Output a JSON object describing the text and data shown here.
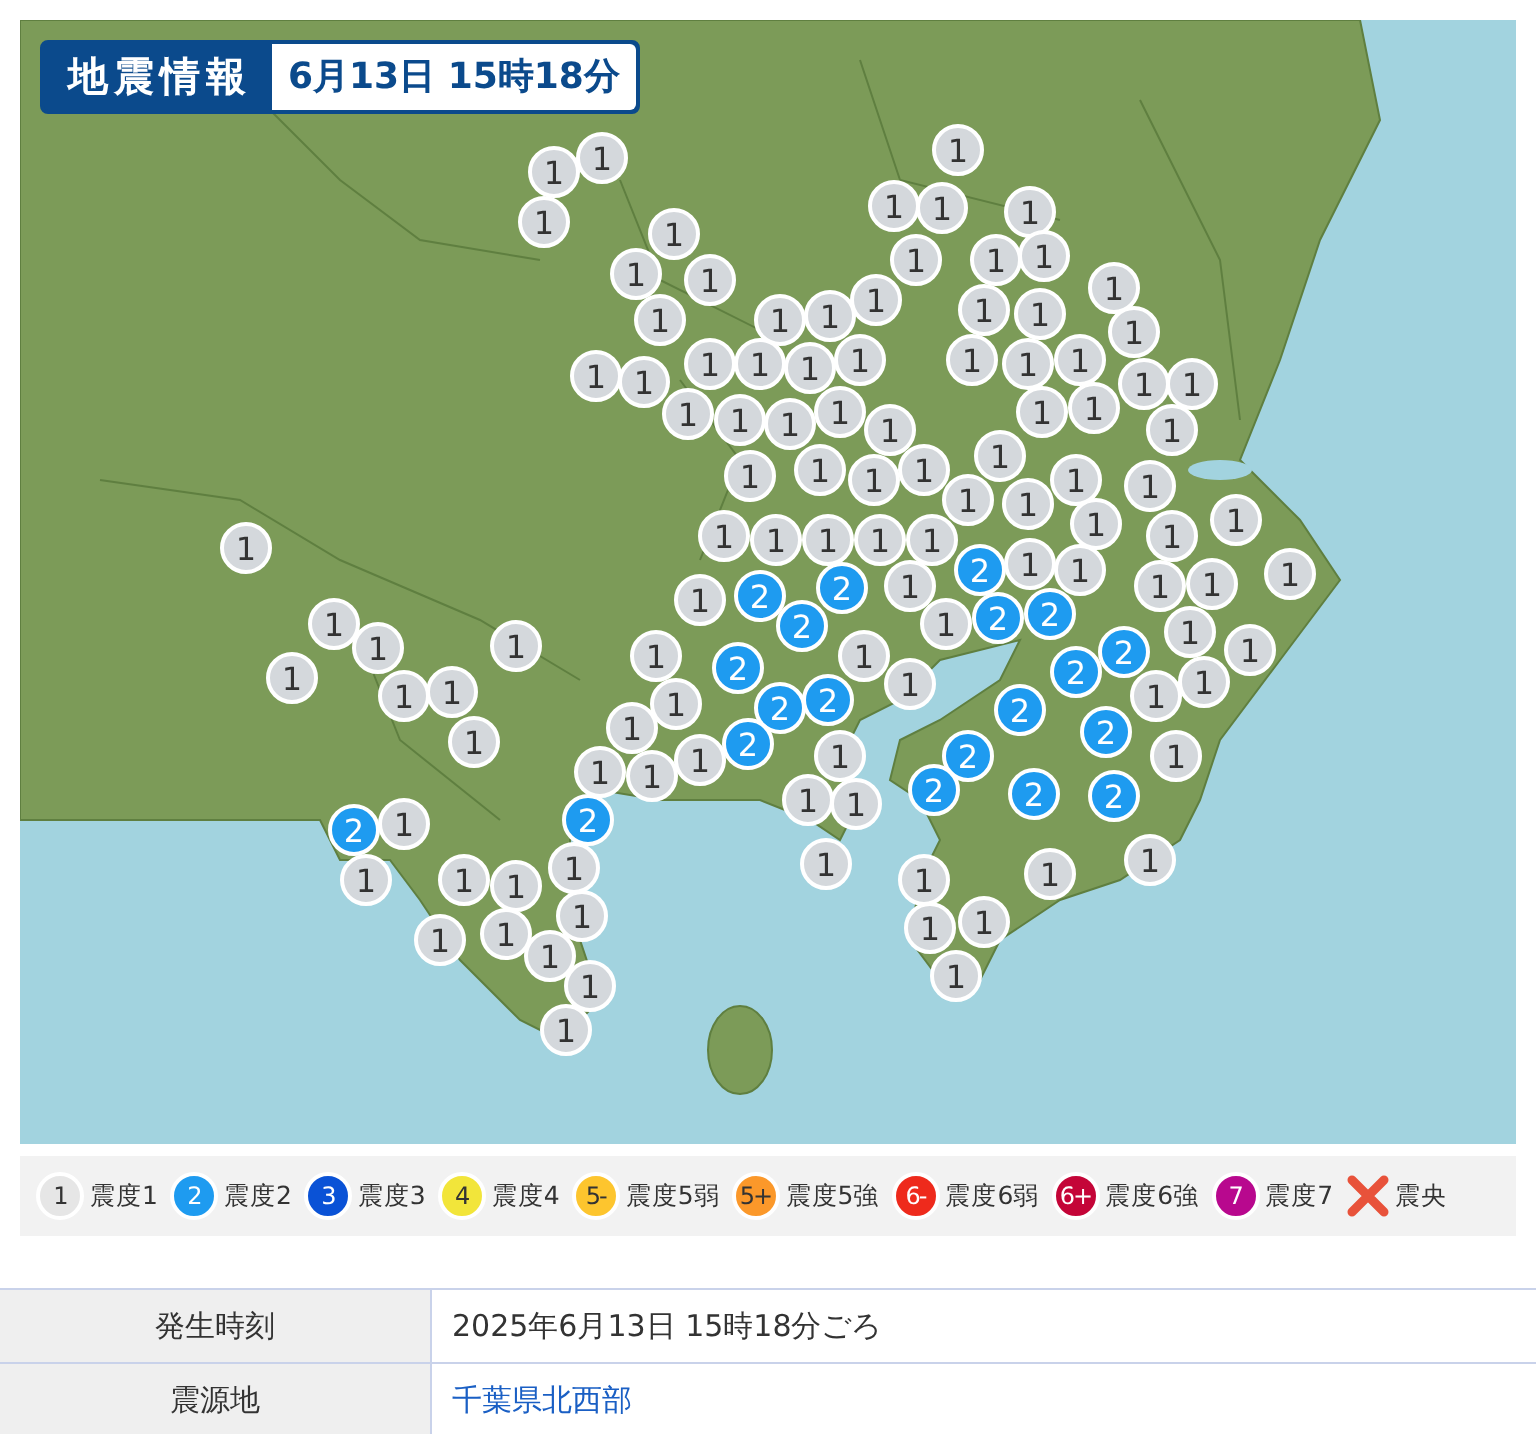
{
  "header": {
    "title": "地震情報",
    "datetime": "6月13日 15時18分"
  },
  "station_groups": [
    {
      "kind": "shindo1",
      "stations": [
        {
          "label": "1"
        },
        {
          "label": "1"
        },
        {
          "label": "1"
        },
        {
          "label": "1"
        },
        {
          "label": "1"
        },
        {
          "label": "1"
        },
        {
          "label": "1"
        },
        {
          "label": "1"
        },
        {
          "label": "1"
        },
        {
          "label": "1"
        },
        {
          "label": "1"
        },
        {
          "label": "1"
        },
        {
          "label": "1"
        },
        {
          "label": "1"
        },
        {
          "label": "1"
        },
        {
          "label": "1"
        },
        {
          "label": "1"
        },
        {
          "label": "1"
        },
        {
          "label": "1"
        },
        {
          "label": "1"
        },
        {
          "label": "1"
        },
        {
          "label": "1"
        },
        {
          "label": "1"
        },
        {
          "label": "1"
        },
        {
          "label": "1"
        },
        {
          "label": "1"
        },
        {
          "label": "1"
        },
        {
          "label": "1"
        },
        {
          "label": "1"
        },
        {
          "label": "1"
        },
        {
          "label": "1"
        },
        {
          "label": "1"
        },
        {
          "label": "1"
        },
        {
          "label": "1"
        },
        {
          "label": "1"
        },
        {
          "label": "1"
        },
        {
          "label": "1"
        },
        {
          "label": "1"
        },
        {
          "label": "1"
        },
        {
          "label": "1"
        },
        {
          "label": "1"
        },
        {
          "label": "1"
        },
        {
          "label": "1"
        },
        {
          "label": "1"
        },
        {
          "label": "1"
        },
        {
          "label": "1"
        },
        {
          "label": "1"
        },
        {
          "label": "1"
        },
        {
          "label": "1"
        },
        {
          "label": "1"
        },
        {
          "label": "1"
        },
        {
          "label": "1"
        },
        {
          "label": "1"
        },
        {
          "label": "1"
        },
        {
          "label": "1"
        },
        {
          "label": "1"
        },
        {
          "label": "1"
        },
        {
          "label": "1"
        },
        {
          "label": "1"
        },
        {
          "label": "1"
        },
        {
          "label": "1"
        },
        {
          "label": "1"
        },
        {
          "label": "1"
        },
        {
          "label": "1"
        },
        {
          "label": "1"
        },
        {
          "label": "1"
        },
        {
          "label": "1"
        },
        {
          "label": "1"
        },
        {
          "label": "1"
        },
        {
          "label": "1"
        },
        {
          "label": "1"
        },
        {
          "label": "1"
        },
        {
          "label": "1"
        },
        {
          "label": "1"
        },
        {
          "label": "1"
        },
        {
          "label": "1"
        },
        {
          "label": "1"
        },
        {
          "label": "1"
        },
        {
          "label": "1"
        },
        {
          "label": "1"
        },
        {
          "label": "1"
        },
        {
          "label": "1"
        },
        {
          "label": "1"
        },
        {
          "label": "1"
        },
        {
          "label": "1"
        },
        {
          "label": "1"
        },
        {
          "label": "1"
        },
        {
          "label": "1"
        },
        {
          "label": "1"
        },
        {
          "label": "1"
        },
        {
          "label": "1"
        },
        {
          "label": "1"
        },
        {
          "label": "1"
        },
        {
          "label": "1"
        },
        {
          "label": "1"
        },
        {
          "label": "1"
        },
        {
          "label": "1"
        },
        {
          "label": "1"
        },
        {
          "label": "1"
        },
        {
          "label": "1"
        },
        {
          "label": "1"
        },
        {
          "label": "1"
        },
        {
          "label": "1"
        },
        {
          "label": "1"
        },
        {
          "label": "1"
        },
        {
          "label": "1"
        },
        {
          "label": "1"
        }
      ]
    },
    {
      "kind": "shindo2",
      "stations": [
        {
          "label": "2"
        },
        {
          "label": "2"
        },
        {
          "label": "2"
        },
        {
          "label": "2"
        },
        {
          "label": "2"
        },
        {
          "label": "2"
        },
        {
          "label": "2"
        },
        {
          "label": "2"
        },
        {
          "label": "2"
        },
        {
          "label": "2"
        },
        {
          "label": "2"
        },
        {
          "label": "2"
        },
        {
          "label": "2"
        },
        {
          "label": "2"
        },
        {
          "label": "2"
        },
        {
          "label": "2"
        },
        {
          "label": "2"
        },
        {
          "label": "2"
        },
        {
          "label": "2"
        },
        {
          "label": "2"
        }
      ]
    }
  ],
  "legend": [
    {
      "kind": "shindo1",
      "symbol": "1",
      "label": "震度1",
      "color": "#e6e6e6"
    },
    {
      "kind": "shindo2",
      "symbol": "2",
      "label": "震度2",
      "color": "#1e9bf0"
    },
    {
      "kind": "shindo3",
      "symbol": "3",
      "label": "震度3",
      "color": "#0a52d6"
    },
    {
      "kind": "shindo4",
      "symbol": "4",
      "label": "震度4",
      "color": "#f2e53a"
    },
    {
      "kind": "shindo5",
      "symbol": "5-",
      "label": "震度5弱",
      "color": "#fdc52e"
    },
    {
      "kind": "shindo5",
      "symbol": "5+",
      "label": "震度5強",
      "color": "#fb982a"
    },
    {
      "kind": "shindo6",
      "symbol": "6-",
      "label": "震度6弱",
      "color": "#ee2a1c"
    },
    {
      "kind": "shindo6",
      "symbol": "6+",
      "label": "震度6強",
      "color": "#c40538"
    },
    {
      "kind": "shindo7",
      "symbol": "7",
      "label": "震度7",
      "color": "#b8088e"
    },
    {
      "kind": "epicenter",
      "label": "震央",
      "color": "#e8523a"
    }
  ],
  "info_table": [
    {
      "label": "発生時刻",
      "value": "2025年6月13日 15時18分ごろ",
      "kind": "text"
    },
    {
      "label": "震源地",
      "value": "千葉県北西部",
      "kind": "link"
    }
  ]
}
